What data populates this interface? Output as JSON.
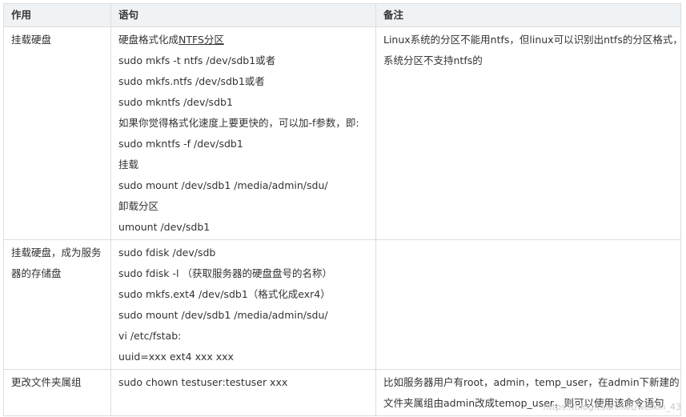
{
  "headers": [
    "作用",
    "语句",
    "备注"
  ],
  "rows": [
    {
      "purpose": "挂载硬盘",
      "statements": {
        "l0_prefix": "硬盘格式化成",
        "l0_link": "NTFS分区",
        "l1": "sudo mkfs -t ntfs /dev/sdb1或者",
        "l2": "sudo mkfs.ntfs /dev/sdb1或者",
        "l3": "sudo mkntfs /dev/sdb1",
        "l4": "如果你觉得格式化速度上要更快的，可以加-f参数，即:",
        "l5": "sudo mkntfs -f /dev/sdb1",
        "l6": "挂载",
        "l7": "sudo mount /dev/sdb1 /media/admin/sdu/",
        "l8": "卸载分区",
        "l9": "umount /dev/sdb1"
      },
      "note_l1": "Linux系统的分区不能用ntfs，但linux可以识别出ntfs的分区格式，",
      "note_l2": "系统分区不支持ntfs的"
    },
    {
      "purpose_l1": "挂载硬盘，成为服务",
      "purpose_l2": "器的存储盘",
      "statements": {
        "l0": "sudo fdisk /dev/sdb",
        "l1": "sudo fdisk -l （获取服务器的硬盘盘号的名称）",
        "l2": "sudo mkfs.ext4 /dev/sdb1（格式化成exr4）",
        "l3": "sudo mount /dev/sdb1 /media/admin/sdu/",
        "l4": "vi /etc/fstab:",
        "l5": "uuid=xxx ext4 xxx xxx"
      }
    },
    {
      "purpose": "更改文件夹属组",
      "statements": {
        "l0": "sudo chown testuser:testuser xxx"
      },
      "note_l1": "比如服务器用户有root，admin，temp_user，在admin下新建的",
      "note_l2": "文件夹属组由admin改成temop_user，则可以使用该命令语句"
    }
  ],
  "watermark": "https://blog.csdn.net/weixin_43"
}
